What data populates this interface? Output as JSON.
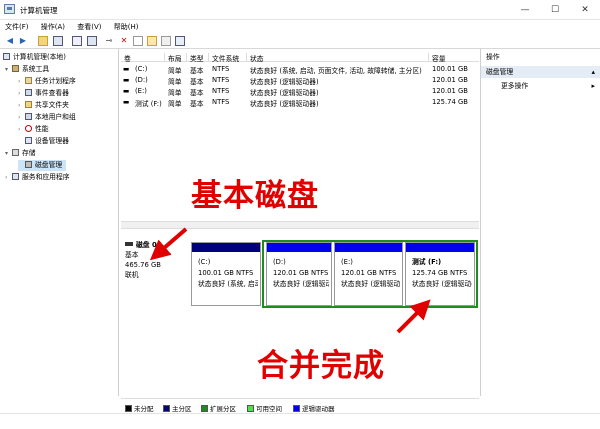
{
  "window": {
    "title": "计算机管理",
    "minimize": "—",
    "maximize": "☐",
    "close": "✕"
  },
  "menu": [
    "文件(F)",
    "操作(A)",
    "查看(V)",
    "帮助(H)"
  ],
  "tree": {
    "root": "计算机管理(本地)",
    "system_tools": "系统工具",
    "task_scheduler": "任务计划程序",
    "event_viewer": "事件查看器",
    "shared_folders": "共享文件夹",
    "local_users": "本地用户和组",
    "performance": "性能",
    "device_manager": "设备管理器",
    "storage": "存储",
    "disk_management": "磁盘管理",
    "services": "服务和应用程序"
  },
  "table": {
    "headers": [
      "卷",
      "布局",
      "类型",
      "文件系统",
      "状态",
      "容量"
    ],
    "rows": [
      {
        "volume": "(C:)",
        "layout": "简单",
        "type": "基本",
        "fs": "NTFS",
        "status": "状态良好 (系统, 启动, 页面文件, 活动, 故障转储, 主分区)",
        "capacity": "100.01 GB"
      },
      {
        "volume": "(D:)",
        "layout": "简单",
        "type": "基本",
        "fs": "NTFS",
        "status": "状态良好 (逻辑驱动器)",
        "capacity": "120.01 GB"
      },
      {
        "volume": "(E:)",
        "layout": "简单",
        "type": "基本",
        "fs": "NTFS",
        "status": "状态良好 (逻辑驱动器)",
        "capacity": "120.01 GB"
      },
      {
        "volume": "测试 (F:)",
        "layout": "简单",
        "type": "基本",
        "fs": "NTFS",
        "status": "状态良好 (逻辑驱动器)",
        "capacity": "125.74 GB"
      }
    ]
  },
  "disk": {
    "name": "磁盘 0",
    "type": "基本",
    "size": "465.76 GB",
    "state": "联机",
    "partitions": [
      {
        "name": "(C:)",
        "size": "100.01 GB NTFS",
        "status": "状态良好 (系统, 启动",
        "bar_color": "#00007a"
      },
      {
        "name": "(D:)",
        "size": "120.01 GB NTFS",
        "status": "状态良好 (逻辑驱动器",
        "bar_color": "#0000f0"
      },
      {
        "name": "(E:)",
        "size": "120.01 GB NTFS",
        "status": "状态良好 (逻辑驱动器",
        "bar_color": "#0000f0"
      },
      {
        "name": "测试 (F:)",
        "size": "125.74 GB NTFS",
        "status": "状态良好 (逻辑驱动器",
        "bar_color": "#0000f0"
      }
    ]
  },
  "legend": [
    {
      "label": "未分配",
      "color": "#000000"
    },
    {
      "label": "主分区",
      "color": "#00007a"
    },
    {
      "label": "扩展分区",
      "color": "#1e8c1e"
    },
    {
      "label": "可用空间",
      "color": "#46e646"
    },
    {
      "label": "逻辑驱动器",
      "color": "#0000f0"
    }
  ],
  "actions": {
    "header": "操作",
    "section": "磁盘管理",
    "more": "更多操作"
  },
  "annotations": {
    "basic_disk": "基本磁盘",
    "merge_done": "合并完成"
  },
  "colors": {
    "annotation": "#e00000",
    "extended_border": "#1e8c1e"
  }
}
